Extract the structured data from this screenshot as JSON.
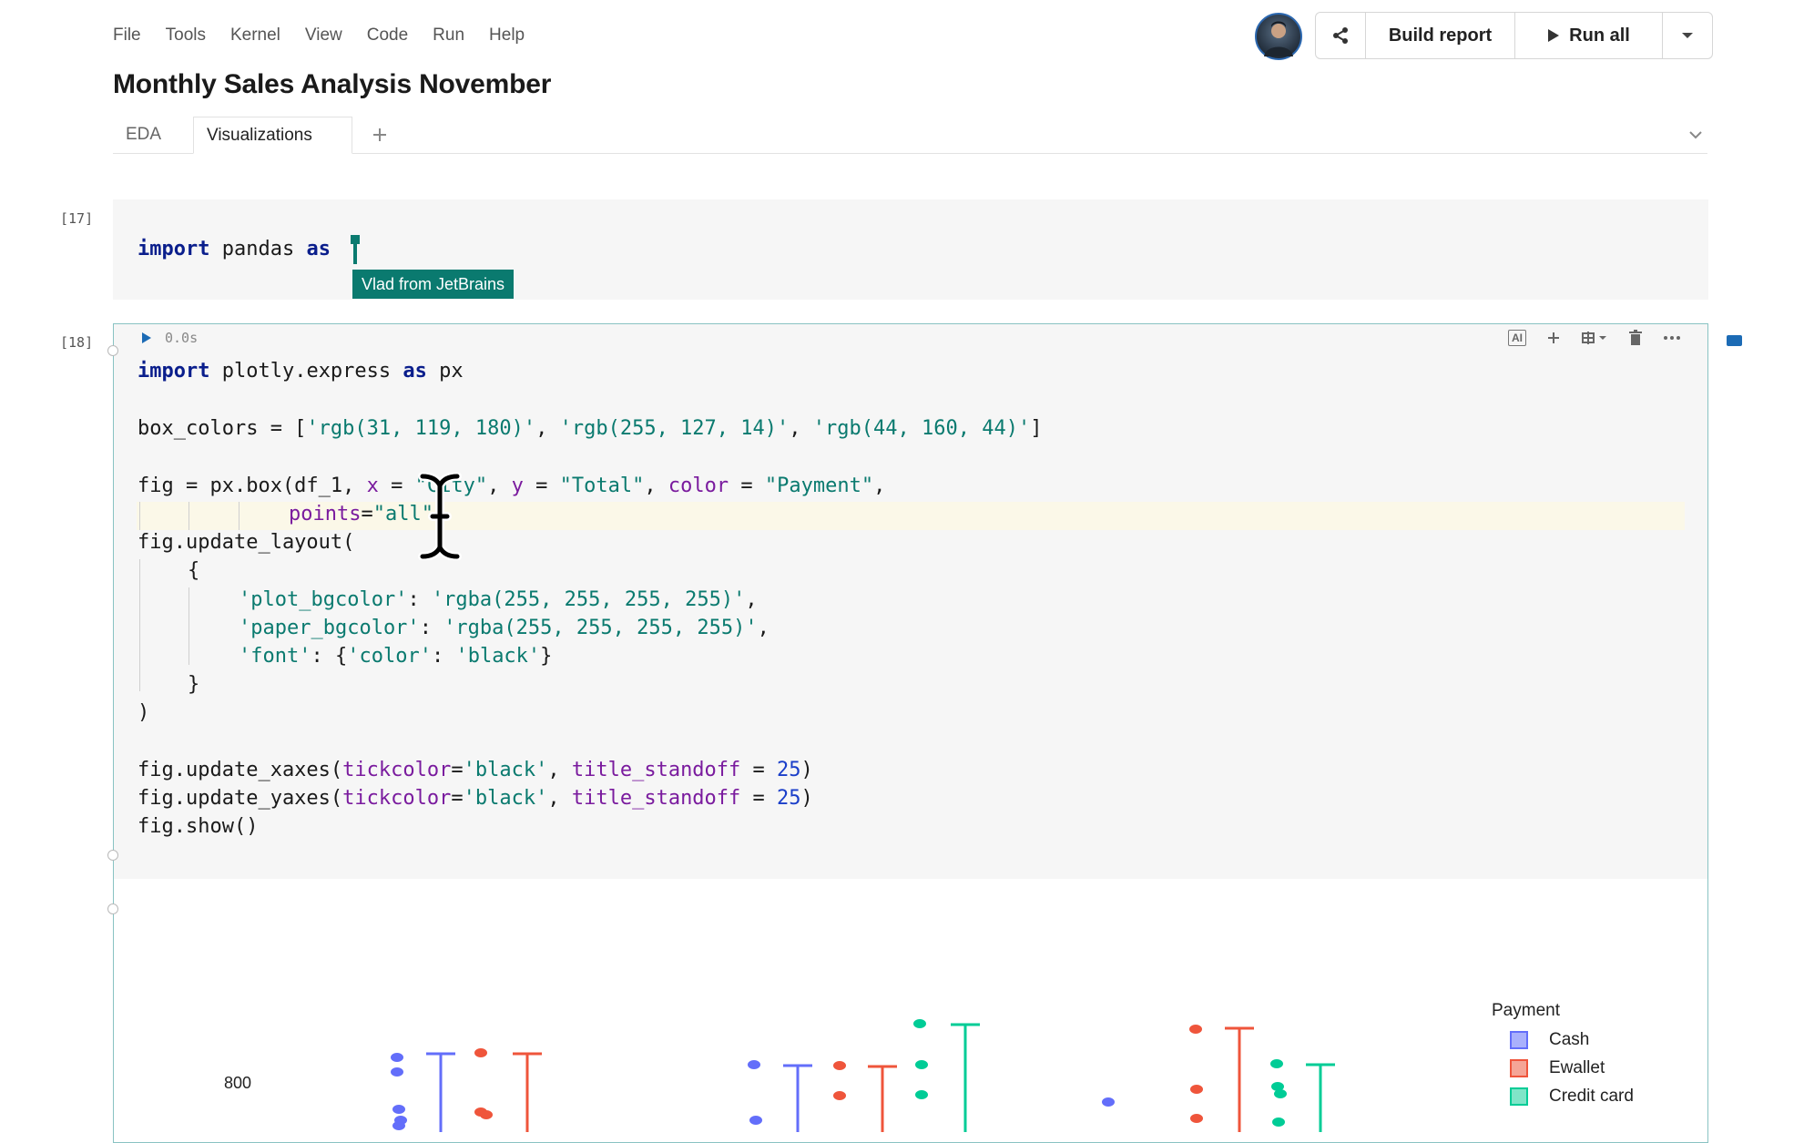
{
  "menu": [
    "File",
    "Tools",
    "Kernel",
    "View",
    "Code",
    "Run",
    "Help"
  ],
  "notebook_title": "Monthly Sales Analysis November",
  "toolbar": {
    "build_report": "Build report",
    "run_all": "Run all"
  },
  "tabs": [
    {
      "label": "EDA"
    },
    {
      "label": "Visualizations",
      "active": true
    }
  ],
  "cell17": {
    "exec_count": "[17]",
    "code": {
      "kw1": "import",
      "mod": " pandas ",
      "kw2": "as"
    },
    "collaborator": "Vlad from JetBrains"
  },
  "cell18": {
    "exec_count": "[18]",
    "duration": "0.0s",
    "tools": {
      "ai": "AI"
    },
    "lines": {
      "l1": {
        "kw1": "import",
        "mid": " plotly.express ",
        "kw2": "as",
        "end": " px"
      },
      "l2": {
        "a": "box_colors = [",
        "s1": "'rgb(31, 119, 180)'",
        "c1": ", ",
        "s2": "'rgb(255, 127, 14)'",
        "c2": ", ",
        "s3": "'rgb(44, 160, 44)'",
        "end": "]"
      },
      "l3": {
        "a": "fig = px.box(df_1, ",
        "p1": "x",
        "b": " = ",
        "s1": "\"City\"",
        "c1": ", ",
        "p2": "y",
        "b2": " = ",
        "s2": "\"Total\"",
        "c2": ", ",
        "p3": "color",
        "b3": " = ",
        "s3": "\"Payment\"",
        "end": ","
      },
      "l4": {
        "p": "points",
        "eq": "=",
        "s": "\"all\""
      },
      "l5": "fig.update_layout(",
      "l6": "{",
      "l7": {
        "k": "'plot_bgcolor'",
        "c": ": ",
        "v": "'rgba(255, 255, 255, 255)'",
        "end": ","
      },
      "l8": {
        "k": "'paper_bgcolor'",
        "c": ": ",
        "v": "'rgba(255, 255, 255, 255)'",
        "end": ","
      },
      "l9": {
        "k": "'font'",
        "c": ": {",
        "k2": "'color'",
        "c2": ": ",
        "v": "'black'",
        "end": "}"
      },
      "l10": "}",
      "l11": ")",
      "l12": {
        "a": "fig.update_xaxes(",
        "p1": "tickcolor",
        "eq": "=",
        "s": "'black'",
        "c": ", ",
        "p2": "title_standoff",
        "b": " = ",
        "n": "25",
        "end": ")"
      },
      "l13": {
        "a": "fig.update_yaxes(",
        "p1": "tickcolor",
        "eq": "=",
        "s": "'black'",
        "c": ", ",
        "p2": "title_standoff",
        "b": " = ",
        "n": "25",
        "end": ")"
      },
      "l14": "fig.show()"
    }
  },
  "chart_data": {
    "type": "box",
    "legend_title": "Payment",
    "series": [
      {
        "name": "Cash",
        "color": "#636efa"
      },
      {
        "name": "Ewallet",
        "color": "#ef553b"
      },
      {
        "name": "Credit card",
        "color": "#00cc96"
      }
    ],
    "y_tick_labels": [
      "800"
    ]
  }
}
